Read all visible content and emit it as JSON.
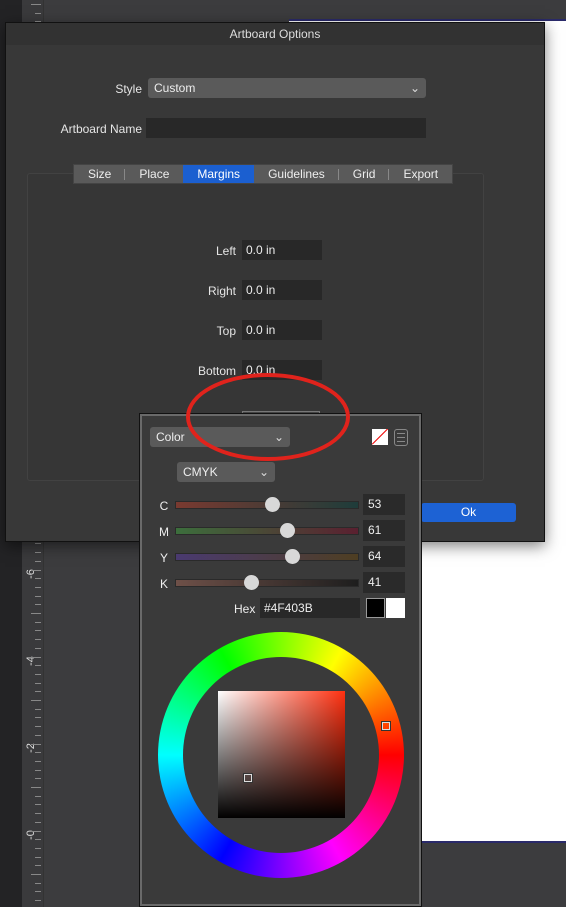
{
  "ruler": {
    "labels": [
      "-6",
      "-4",
      "-2",
      "-0"
    ]
  },
  "dialog": {
    "title": "Artboard Options",
    "style_label": "Style",
    "style_value": "Custom",
    "name_label": "Artboard Name",
    "name_value": "",
    "tabs": [
      {
        "label": "Size"
      },
      {
        "label": "Place"
      },
      {
        "label": "Margins",
        "active": true
      },
      {
        "label": "Guidelines"
      },
      {
        "label": "Grid"
      },
      {
        "label": "Export"
      }
    ],
    "margins": [
      {
        "label": "Left",
        "value": "0.0 in"
      },
      {
        "label": "Right",
        "value": "0.0 in"
      },
      {
        "label": "Top",
        "value": "0.0 in"
      },
      {
        "label": "Bottom",
        "value": "0.0 in"
      }
    ],
    "ok_label": "Ok",
    "accent": "#1d62d4"
  },
  "popover": {
    "mode_value": "Color",
    "model_value": "CMYK",
    "sliders": [
      {
        "label": "C",
        "value": "53",
        "percent": 53
      },
      {
        "label": "M",
        "value": "61",
        "percent": 61
      },
      {
        "label": "Y",
        "value": "64",
        "percent": 64
      },
      {
        "label": "K",
        "value": "41",
        "percent": 41
      }
    ],
    "hex_label": "Hex",
    "hex_value": "#4F403B",
    "icons": [
      "no-color-icon",
      "menu-icon"
    ]
  },
  "annotation": {
    "color": "#e0231c"
  }
}
